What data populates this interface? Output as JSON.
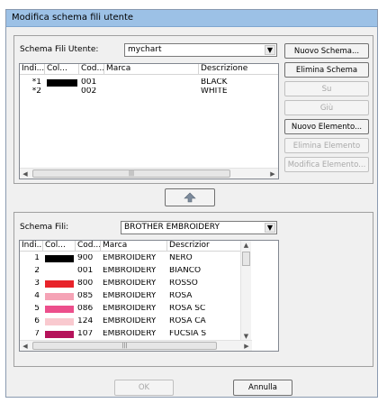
{
  "window": {
    "title": "Modifica schema fili utente"
  },
  "user_scheme": {
    "label": "Schema Fili Utente:",
    "selected": "mychart",
    "columns": [
      "Indi...",
      "Col...",
      "Cod...",
      "Marca",
      "Descrizione"
    ],
    "rows": [
      {
        "index": "*1",
        "color": "#000000",
        "code": "001",
        "brand": "",
        "description": "BLACK"
      },
      {
        "index": "*2",
        "color": "#ffffff",
        "code": "002",
        "brand": "",
        "description": "WHITE"
      }
    ]
  },
  "side_buttons": {
    "new_scheme": "Nuovo Schema...",
    "delete_scheme": "Elimina Schema",
    "up": "Su",
    "down": "Giù",
    "new_item": "Nuovo Elemento...",
    "delete_item": "Elimina Elemento",
    "edit_item": "Modifica Elemento..."
  },
  "transfer_button": {
    "icon": "arrow-up-icon"
  },
  "thread_scheme": {
    "label": "Schema Fili:",
    "selected": "BROTHER EMBROIDERY",
    "columns": [
      "Indi...",
      "Col...",
      "Cod...",
      "Marca",
      "Descrizior"
    ],
    "rows": [
      {
        "index": "1",
        "color": "#000000",
        "code": "900",
        "brand": "EMBROIDERY",
        "description": "NERO"
      },
      {
        "index": "2",
        "color": "#ffffff",
        "code": "001",
        "brand": "EMBROIDERY",
        "description": "BIANCO"
      },
      {
        "index": "3",
        "color": "#e8232a",
        "code": "800",
        "brand": "EMBROIDERY",
        "description": "ROSSO"
      },
      {
        "index": "4",
        "color": "#f5a3b6",
        "code": "085",
        "brand": "EMBROIDERY",
        "description": "ROSA"
      },
      {
        "index": "5",
        "color": "#ec4f8c",
        "code": "086",
        "brand": "EMBROIDERY",
        "description": "ROSA SC"
      },
      {
        "index": "6",
        "color": "#f9c9cf",
        "code": "124",
        "brand": "EMBROIDERY",
        "description": "ROSA CA"
      },
      {
        "index": "7",
        "color": "#b5125a",
        "code": "107",
        "brand": "EMBROIDERY",
        "description": "FUCSIA S"
      }
    ]
  },
  "footer": {
    "ok": "OK",
    "cancel": "Annulla"
  }
}
